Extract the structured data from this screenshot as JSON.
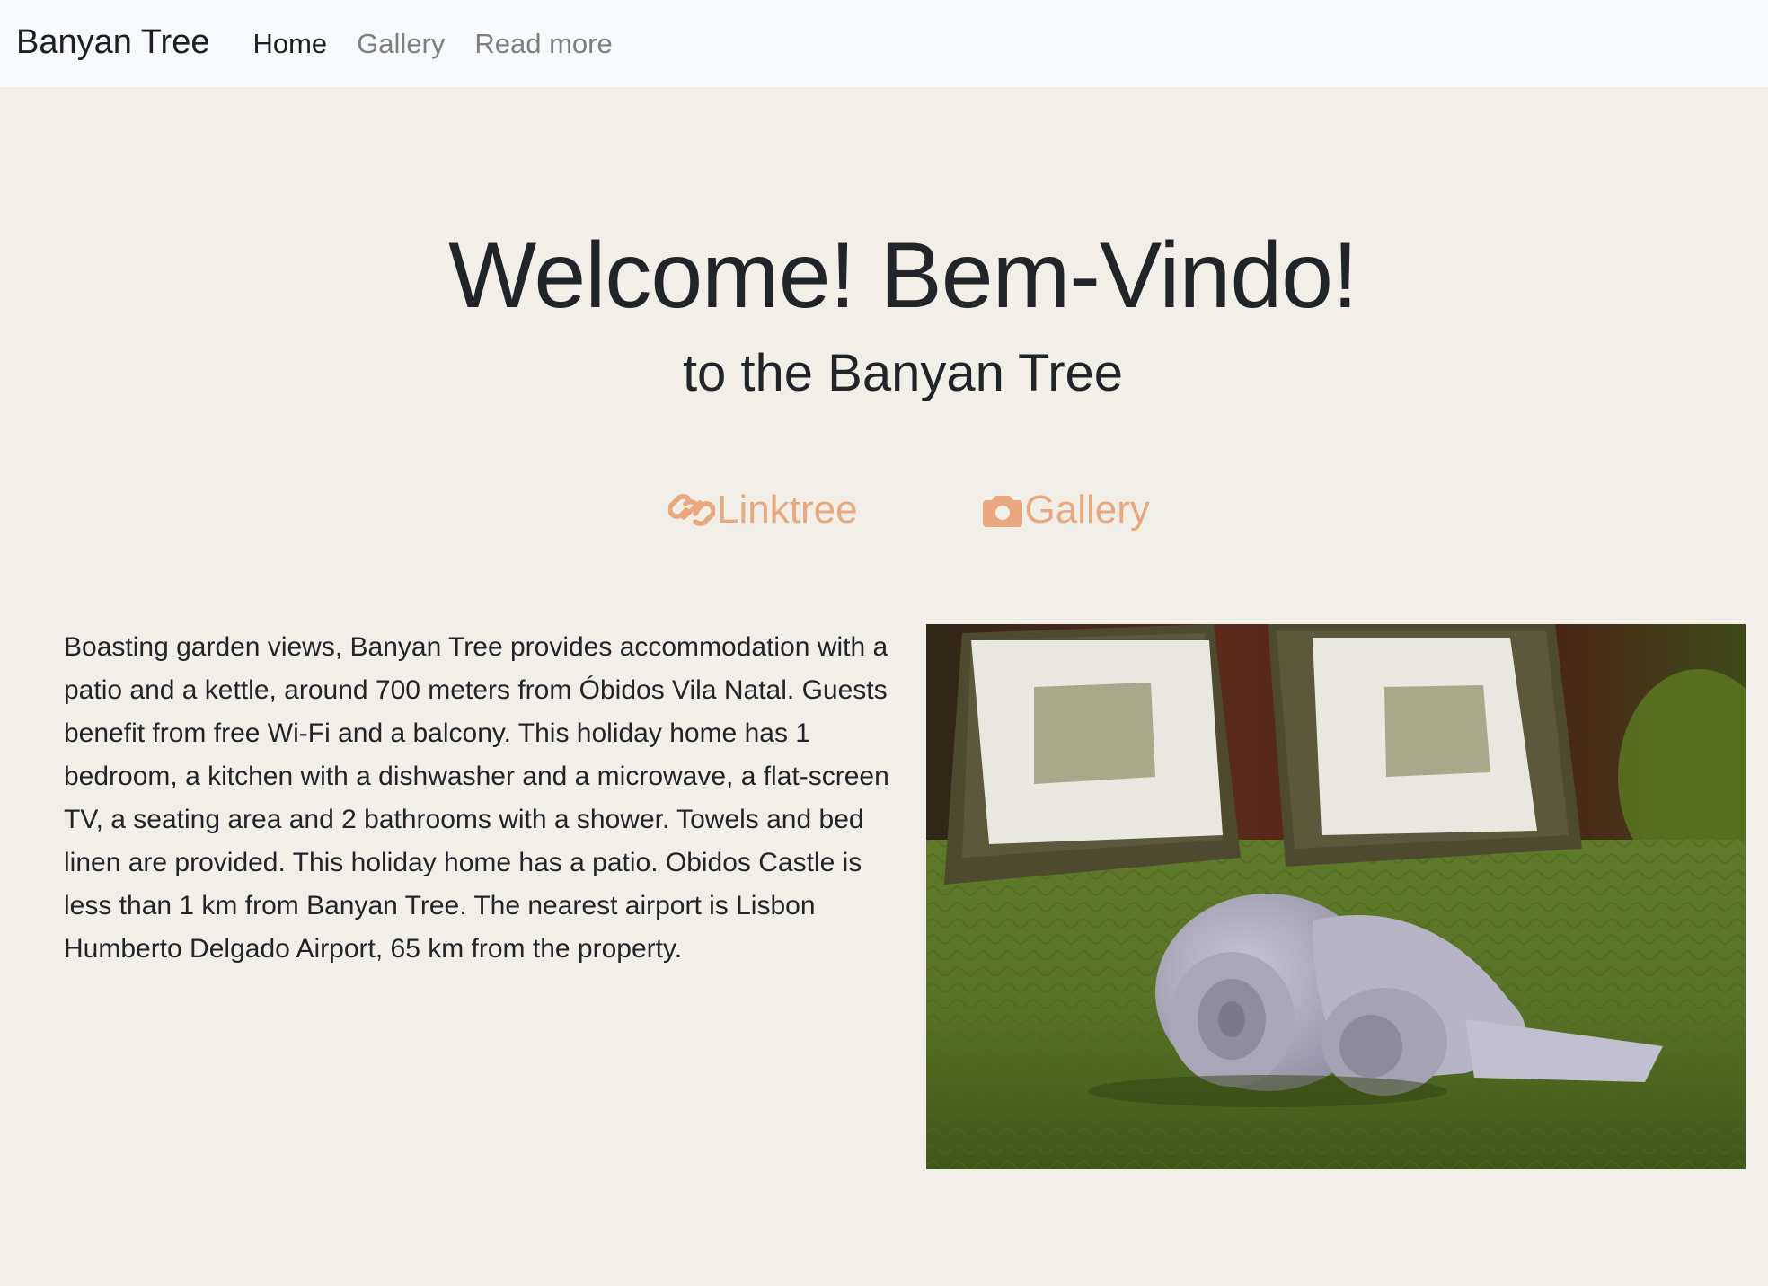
{
  "navbar": {
    "brand": "Banyan Tree",
    "links": [
      {
        "label": "Home",
        "active": true
      },
      {
        "label": "Gallery",
        "active": false
      },
      {
        "label": "Read more",
        "active": false
      }
    ]
  },
  "hero": {
    "title": "Welcome! Bem-Vindo!",
    "subtitle": "to the Banyan Tree",
    "links": [
      {
        "label": "Linktree",
        "icon": "link-icon"
      },
      {
        "label": "Gallery",
        "icon": "camera-icon"
      }
    ],
    "accent_color": "#eaa87e"
  },
  "about": {
    "text": "Boasting garden views, Banyan Tree provides accommodation with a patio and a kettle, around 700 meters from Óbidos Vila Natal. Guests benefit from free Wi-Fi and a balcony. This holiday home has 1 bedroom, a kitchen with a dishwasher and a microwave, a flat-screen TV, a seating area and 2 bathrooms with a shower. Towels and bed linen are provided. This holiday home has a patio. Obidos Castle is less than 1 km from Banyan Tree. The nearest airport is Lisbon Humberto Delgado Airport, 65 km from the property."
  },
  "colors": {
    "page_background": "#f1efe7",
    "navbar_background": "#f8f9fa",
    "text": "#212529",
    "nav_inactive": "#7d7f81"
  }
}
